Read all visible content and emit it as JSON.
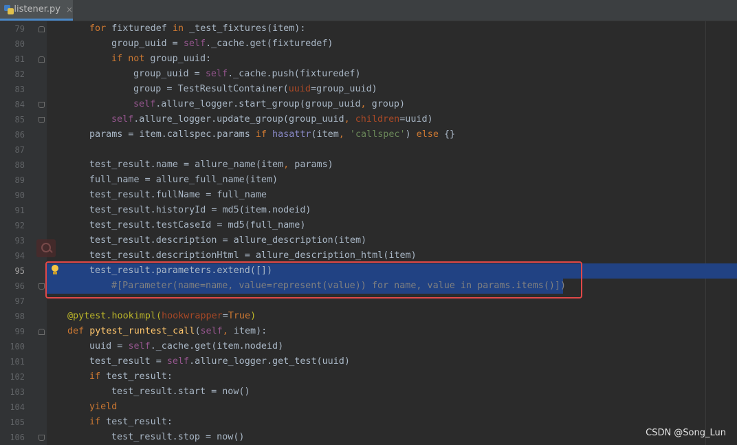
{
  "tab": {
    "filename": "listener.py",
    "close": "×"
  },
  "lines": [
    {
      "no": "79"
    },
    {
      "no": "80"
    },
    {
      "no": "81"
    },
    {
      "no": "82"
    },
    {
      "no": "83"
    },
    {
      "no": "84"
    },
    {
      "no": "85"
    },
    {
      "no": "86"
    },
    {
      "no": "87"
    },
    {
      "no": "88"
    },
    {
      "no": "89"
    },
    {
      "no": "90"
    },
    {
      "no": "91"
    },
    {
      "no": "92"
    },
    {
      "no": "93"
    },
    {
      "no": "94"
    },
    {
      "no": "95"
    },
    {
      "no": "96"
    },
    {
      "no": "97"
    },
    {
      "no": "98"
    },
    {
      "no": "99"
    },
    {
      "no": "100"
    },
    {
      "no": "101"
    },
    {
      "no": "102"
    },
    {
      "no": "103"
    },
    {
      "no": "104"
    },
    {
      "no": "105"
    },
    {
      "no": "106"
    }
  ],
  "code": {
    "l79": [
      "for",
      " fixturedef ",
      "in",
      " _test_fixtures(item):"
    ],
    "l80": [
      "group_uuid = ",
      "self",
      "._cache.get(fixturedef)"
    ],
    "l81": [
      "if",
      " ",
      "not",
      " group_uuid:"
    ],
    "l82": [
      "group_uuid = ",
      "self",
      "._cache.push(fixturedef)"
    ],
    "l83": [
      "group = TestResultContainer(",
      "uuid",
      "=group_uuid)"
    ],
    "l84": [
      "self",
      ".allure_logger.start_group(group_uuid",
      ",",
      " group)"
    ],
    "l85": [
      "self",
      ".allure_logger.update_group(group_uuid",
      ",",
      " ",
      "children",
      "=uuid)"
    ],
    "l86": [
      "params = item.callspec.params ",
      "if",
      " ",
      "hasattr",
      "(item",
      ",",
      " ",
      "'callspec'",
      ") ",
      "else",
      " {}"
    ],
    "l88": [
      "test_result.name = allure_name(item",
      ",",
      " params)"
    ],
    "l89": "full_name = allure_full_name(item)",
    "l90": "test_result.fullName = full_name",
    "l91": "test_result.historyId = md5(item.nodeid)",
    "l92": "test_result.testCaseId = md5(full_name)",
    "l93": "test_result.description = allure_description(item)",
    "l94": "test_result.descriptionHtml = allure_description_html(item)",
    "l95": "test_result.parameters.extend([])",
    "l96": "#[Parameter(name=name, value=represent(value)) for name, value in params.items()])",
    "l98": [
      "@pytest.hookimpl(",
      "hookwrapper",
      "=",
      "True",
      ")"
    ],
    "l99": [
      "def",
      " ",
      "pytest_runtest_call",
      "(",
      "self",
      ",",
      " item):"
    ],
    "l100": [
      "uuid = ",
      "self",
      "._cache.get(item.nodeid)"
    ],
    "l101": [
      "test_result = ",
      "self",
      ".allure_logger.get_test(uuid)"
    ],
    "l102": [
      "if",
      " test_result:"
    ],
    "l103": "test_result.start = now()",
    "l104": "yield",
    "l105": [
      "if",
      " test_result:"
    ],
    "l106": "test_result.stop = now()"
  },
  "watermark": "CSDN @Song_Lun"
}
